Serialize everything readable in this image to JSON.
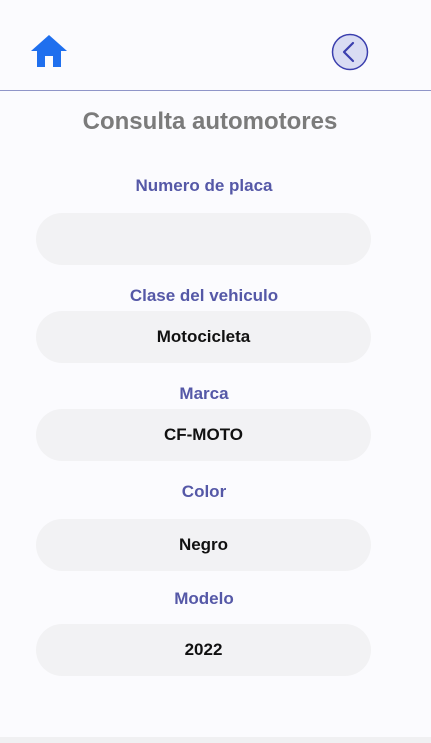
{
  "colors": {
    "accent_blue": "#1f6fee",
    "label_purple": "#5558a7",
    "title_gray": "#7b7b7b",
    "field_bg": "#f2f2f4",
    "page_bg": "#fbfbfe"
  },
  "header": {
    "home_icon": "home-icon",
    "back_icon": "chevron-left-circle-icon"
  },
  "page": {
    "title": "Consulta automotores"
  },
  "fields": [
    {
      "label": "Numero de placa",
      "value": ""
    },
    {
      "label": "Clase del vehiculo",
      "value": "Motocicleta"
    },
    {
      "label": "Marca",
      "value": "CF-MOTO"
    },
    {
      "label": "Color",
      "value": "Negro"
    },
    {
      "label": "Modelo",
      "value": "2022"
    }
  ]
}
